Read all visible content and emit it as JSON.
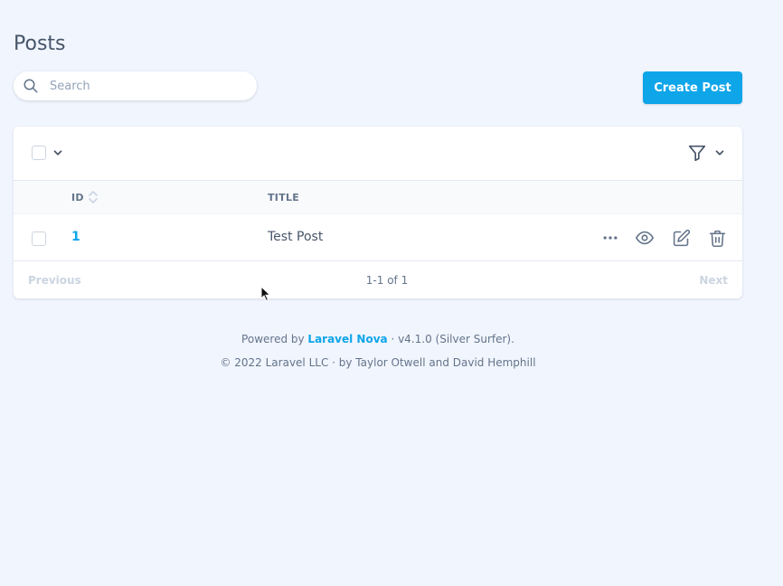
{
  "page": {
    "title": "Posts"
  },
  "search": {
    "placeholder": "Search",
    "value": ""
  },
  "toolbar": {
    "create_label": "Create Post"
  },
  "table": {
    "columns": [
      {
        "label": "ID",
        "sortable": true
      },
      {
        "label": "TITLE",
        "sortable": false
      }
    ],
    "rows": [
      {
        "id": "1",
        "title": "Test Post"
      }
    ]
  },
  "pagination": {
    "previous_label": "Previous",
    "info": "1-1 of 1",
    "next_label": "Next"
  },
  "footer": {
    "powered_prefix": "Powered by ",
    "nova_link": "Laravel Nova",
    "version": " · v4.1.0 (Silver Surfer).",
    "copyright": "© 2022 Laravel LLC · by Taylor Otwell and David Hemphill"
  },
  "icons": {
    "search": "search-icon",
    "chevron": "chevron-down-icon",
    "filter": "filter-icon",
    "sort": "sort-icon",
    "more": "ellipsis-icon",
    "view": "eye-icon",
    "edit": "pencil-square-icon",
    "delete": "trash-icon"
  },
  "colors": {
    "primary": "#0ea5e9",
    "background": "#f1f5fe",
    "muted": "#94a3b8"
  }
}
